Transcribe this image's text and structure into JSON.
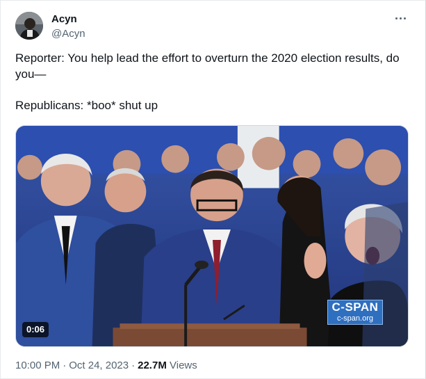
{
  "author": {
    "display_name": "Acyn",
    "handle": "@Acyn"
  },
  "tweet": {
    "text": "Reporter: You help lead the effort to overturn the 2020 election results, do you—\n\nRepublicans: *boo* shut up"
  },
  "media": {
    "duration": "0:06",
    "watermark_logo": "C-SPAN",
    "watermark_url": "c-span.org",
    "colors": {
      "backdrop_blue": "#2f4fa8",
      "cspan_blue": "#2f6fc0"
    }
  },
  "metadata": {
    "time": "10:00 PM",
    "date": "Oct 24, 2023",
    "views_count": "22.7M",
    "views_label": "Views"
  },
  "icons": {
    "more": "more-options-icon"
  },
  "colors": {
    "text_primary": "#0f1419",
    "text_secondary": "#536471",
    "border": "#cfd9de"
  }
}
